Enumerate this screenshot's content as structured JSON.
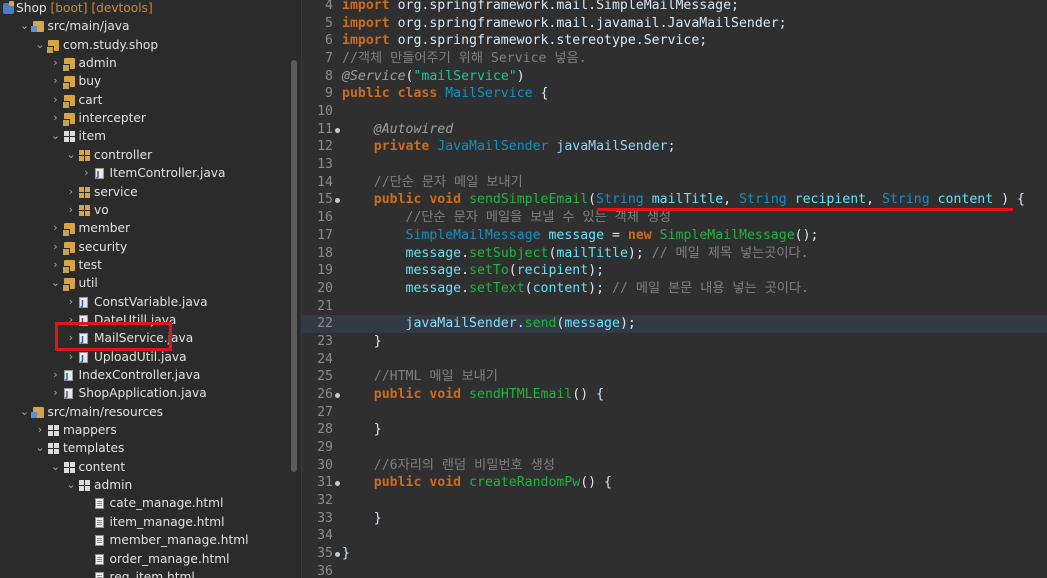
{
  "explorer": {
    "items": [
      {
        "arrow": "",
        "icon": "project",
        "label": "Shop",
        "decoration": "[boot] [devtools]"
      },
      {
        "arrow": "⌄",
        "icon": "srcfolder",
        "label": "src/main/java"
      },
      {
        "arrow": "⌄",
        "icon": "package",
        "label": "com.study.shop"
      },
      {
        "arrow": "›",
        "icon": "package",
        "label": "admin"
      },
      {
        "arrow": "›",
        "icon": "package",
        "label": "buy"
      },
      {
        "arrow": "›",
        "icon": "package",
        "label": "cart"
      },
      {
        "arrow": "›",
        "icon": "package",
        "label": "intercepter"
      },
      {
        "arrow": "⌄",
        "icon": "pkgwhite",
        "label": "item"
      },
      {
        "arrow": "⌄",
        "icon": "pkgempty",
        "label": "controller"
      },
      {
        "arrow": "›",
        "icon": "java",
        "label": "ItemController.java"
      },
      {
        "arrow": "›",
        "icon": "pkgempty",
        "label": "service"
      },
      {
        "arrow": "›",
        "icon": "pkgempty",
        "label": "vo"
      },
      {
        "arrow": "›",
        "icon": "package",
        "label": "member"
      },
      {
        "arrow": "›",
        "icon": "package",
        "label": "security"
      },
      {
        "arrow": "›",
        "icon": "package",
        "label": "test"
      },
      {
        "arrow": "⌄",
        "icon": "package",
        "label": "util"
      },
      {
        "arrow": "›",
        "icon": "java",
        "label": "ConstVariable.java"
      },
      {
        "arrow": "›",
        "icon": "java",
        "label": "DateUtill.java"
      },
      {
        "arrow": "›",
        "icon": "java",
        "label": "MailService.java"
      },
      {
        "arrow": "›",
        "icon": "java",
        "label": "UploadUtil.java"
      },
      {
        "arrow": "›",
        "icon": "java",
        "label": "IndexController.java"
      },
      {
        "arrow": "›",
        "icon": "java",
        "label": "ShopApplication.java"
      },
      {
        "arrow": "⌄",
        "icon": "srcfolder",
        "label": "src/main/resources"
      },
      {
        "arrow": "›",
        "icon": "pkgwhite",
        "label": "mappers"
      },
      {
        "arrow": "⌄",
        "icon": "pkgwhite",
        "label": "templates"
      },
      {
        "arrow": "⌄",
        "icon": "pkgwhite",
        "label": "content"
      },
      {
        "arrow": "⌄",
        "icon": "pkgwhite",
        "label": "admin"
      },
      {
        "arrow": "",
        "icon": "html",
        "label": "cate_manage.html"
      },
      {
        "arrow": "",
        "icon": "html",
        "label": "item_manage.html"
      },
      {
        "arrow": "",
        "icon": "html",
        "label": "member_manage.html"
      },
      {
        "arrow": "",
        "icon": "html",
        "label": "order_manage.html"
      },
      {
        "arrow": "",
        "icon": "html",
        "label": "reg_item.html"
      }
    ]
  },
  "editor": {
    "lines": [
      {
        "n": "4",
        "tokens": [
          [
            "kw",
            "import"
          ],
          [
            "plain",
            " org.springframework.mail.SimpleMailMessage;"
          ]
        ]
      },
      {
        "n": "5",
        "tokens": [
          [
            "kw",
            "import"
          ],
          [
            "plain",
            " org.springframework.mail.javamail.JavaMailSender;"
          ]
        ]
      },
      {
        "n": "6",
        "tokens": [
          [
            "kw",
            "import"
          ],
          [
            "plain",
            " org.springframework.stereotype.Service;"
          ]
        ]
      },
      {
        "n": "7",
        "tokens": [
          [
            "cm",
            "//객체 만들어주기 위해 Service 넣음."
          ]
        ]
      },
      {
        "n": "8",
        "tokens": [
          [
            "ann",
            "@Service"
          ],
          [
            "plain",
            "("
          ],
          [
            "str",
            "\"mailService\""
          ],
          [
            "plain",
            ")"
          ]
        ]
      },
      {
        "n": "9",
        "tokens": [
          [
            "kw",
            "public class"
          ],
          [
            "plain",
            " "
          ],
          [
            "ty",
            "MailService"
          ],
          [
            "plain",
            " {"
          ]
        ]
      },
      {
        "n": "10",
        "tokens": []
      },
      {
        "n": "11",
        "fold": true,
        "tokens": [
          [
            "plain",
            "    "
          ],
          [
            "ann",
            "@Autowired"
          ]
        ]
      },
      {
        "n": "12",
        "tokens": [
          [
            "plain",
            "    "
          ],
          [
            "kw",
            "private"
          ],
          [
            "plain",
            " "
          ],
          [
            "ty",
            "JavaMailSender"
          ],
          [
            "plain",
            " "
          ],
          [
            "field",
            "javaMailSender"
          ],
          [
            "plain",
            ";"
          ]
        ]
      },
      {
        "n": "13",
        "tokens": []
      },
      {
        "n": "14",
        "tokens": [
          [
            "plain",
            "    "
          ],
          [
            "cm",
            "//단순 문자 메일 보내기"
          ]
        ]
      },
      {
        "n": "15",
        "fold": true,
        "tokens": [
          [
            "plain",
            "    "
          ],
          [
            "kw",
            "public void"
          ],
          [
            "plain",
            " "
          ],
          [
            "fn",
            "sendSimpleEmail"
          ],
          [
            "plain",
            "("
          ],
          [
            "ty",
            "String"
          ],
          [
            "plain",
            " "
          ],
          [
            "var",
            "mailTitle"
          ],
          [
            "plain",
            ", "
          ],
          [
            "ty",
            "String"
          ],
          [
            "plain",
            " "
          ],
          [
            "var",
            "recipient"
          ],
          [
            "plain",
            ", "
          ],
          [
            "ty",
            "String"
          ],
          [
            "plain",
            " "
          ],
          [
            "var",
            "content"
          ],
          [
            "plain",
            " ) {"
          ]
        ]
      },
      {
        "n": "16",
        "tokens": [
          [
            "plain",
            "        "
          ],
          [
            "cm",
            "//단순 문자 메일을 보낼 수 있는 객체 생성"
          ]
        ]
      },
      {
        "n": "17",
        "tokens": [
          [
            "plain",
            "        "
          ],
          [
            "ty",
            "SimpleMailMessage"
          ],
          [
            "plain",
            " "
          ],
          [
            "var",
            "message"
          ],
          [
            "plain",
            " = "
          ],
          [
            "kw",
            "new"
          ],
          [
            "plain",
            " "
          ],
          [
            "fn",
            "SimpleMailMessage"
          ],
          [
            "plain",
            "();"
          ]
        ]
      },
      {
        "n": "18",
        "tokens": [
          [
            "plain",
            "        "
          ],
          [
            "var",
            "message"
          ],
          [
            "plain",
            "."
          ],
          [
            "fn",
            "setSubject"
          ],
          [
            "plain",
            "("
          ],
          [
            "var",
            "mailTitle"
          ],
          [
            "plain",
            "); "
          ],
          [
            "cm",
            "// 메일 제목 넣는곳이다."
          ]
        ]
      },
      {
        "n": "19",
        "tokens": [
          [
            "plain",
            "        "
          ],
          [
            "var",
            "message"
          ],
          [
            "plain",
            "."
          ],
          [
            "fn",
            "setTo"
          ],
          [
            "plain",
            "("
          ],
          [
            "var",
            "recipient"
          ],
          [
            "plain",
            ");"
          ]
        ]
      },
      {
        "n": "20",
        "tokens": [
          [
            "plain",
            "        "
          ],
          [
            "var",
            "message"
          ],
          [
            "plain",
            "."
          ],
          [
            "fn",
            "setText"
          ],
          [
            "plain",
            "("
          ],
          [
            "var",
            "content"
          ],
          [
            "plain",
            "); "
          ],
          [
            "cm",
            "// 메일 본문 내용 넣는 곳이다."
          ]
        ]
      },
      {
        "n": "21",
        "tokens": []
      },
      {
        "n": "22",
        "current": true,
        "tokens": [
          [
            "plain",
            "        "
          ],
          [
            "field",
            "javaMailSender"
          ],
          [
            "plain",
            "."
          ],
          [
            "fn",
            "send"
          ],
          [
            "plain",
            "("
          ],
          [
            "var",
            "message"
          ],
          [
            "plain",
            ");"
          ]
        ]
      },
      {
        "n": "23",
        "tokens": [
          [
            "plain",
            "    }"
          ]
        ]
      },
      {
        "n": "24",
        "tokens": []
      },
      {
        "n": "25",
        "tokens": [
          [
            "plain",
            "    "
          ],
          [
            "cm",
            "//HTML 메일 보내기"
          ]
        ]
      },
      {
        "n": "26",
        "fold": true,
        "tokens": [
          [
            "plain",
            "    "
          ],
          [
            "kw",
            "public void"
          ],
          [
            "plain",
            " "
          ],
          [
            "fn",
            "sendHTMLEmail"
          ],
          [
            "plain",
            "() {"
          ]
        ]
      },
      {
        "n": "27",
        "tokens": []
      },
      {
        "n": "28",
        "tokens": [
          [
            "plain",
            "    }"
          ]
        ]
      },
      {
        "n": "29",
        "tokens": []
      },
      {
        "n": "30",
        "tokens": [
          [
            "plain",
            "    "
          ],
          [
            "cm",
            "//6자리의 랜덤 비밀번호 생성"
          ]
        ]
      },
      {
        "n": "31",
        "fold": true,
        "tokens": [
          [
            "plain",
            "    "
          ],
          [
            "kw",
            "public void"
          ],
          [
            "plain",
            " "
          ],
          [
            "fn",
            "createRandomPw"
          ],
          [
            "plain",
            "() {"
          ]
        ]
      },
      {
        "n": "32",
        "tokens": []
      },
      {
        "n": "33",
        "tokens": [
          [
            "plain",
            "    }"
          ]
        ]
      },
      {
        "n": "34",
        "tokens": []
      },
      {
        "n": "35",
        "fold": true,
        "tokens": [
          [
            "plain",
            "}"
          ]
        ]
      },
      {
        "n": "36",
        "tokens": []
      }
    ]
  },
  "colors": {
    "highlight": "#e3121b",
    "keyword": "#cc6c1d",
    "type": "#1290c3",
    "method": "#1eb540",
    "string": "#17c6a3",
    "comment": "#808080"
  }
}
